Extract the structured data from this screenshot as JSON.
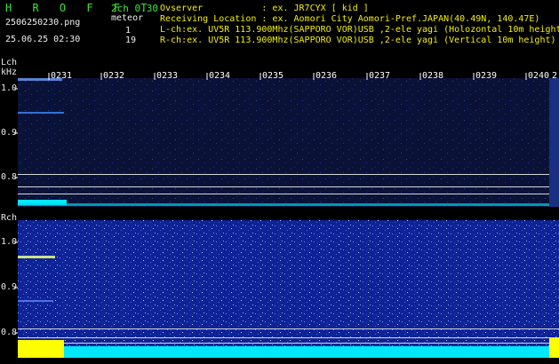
{
  "header": {
    "app_title": "H R O F F T",
    "version": "2ch 0.30",
    "filename": "2506250230.png",
    "timestamp": "25.06.25 02:30",
    "meteor_label": "meteor",
    "meteor_count_l": "1",
    "meteor_count_r": "19",
    "observer": "Ovserver           : ex. JR7CYX [ kid ]",
    "location": "Receiving Location : ex. Aomori City Aomori-Pref.JAPAN(40.49N, 140.47E)",
    "lch_info": "L-ch:ex. UV5R 113.900Mhz(SAPPORO VOR)USB ,2-ele yagi (Holozontal 10m height)",
    "rch_info": "R-ch:ex. UV5R 113.900Mhz(SAPPORO VOR)USB ,2-ele yagi (Vertical 10m height)"
  },
  "time_axis": {
    "labels": [
      "0231",
      "0232",
      "0233",
      "0234",
      "0235",
      "0236",
      "0237",
      "0238",
      "0239",
      "0240",
      "2"
    ]
  },
  "lch": {
    "label": "Lch",
    "unit": "kHz",
    "ticks": [
      "1.0",
      "0.9",
      "0.8"
    ]
  },
  "rch": {
    "label": "Rch",
    "ticks": [
      "1.0",
      "0.9",
      "0.8"
    ]
  },
  "colors": {
    "header_green": "#37e637",
    "header_yellow": "#f4f000",
    "lch_background": "#0a1238",
    "rch_background": "#0f2296",
    "signal_cyan": "#00e8ff",
    "signal_yellow": "#ffff00"
  }
}
